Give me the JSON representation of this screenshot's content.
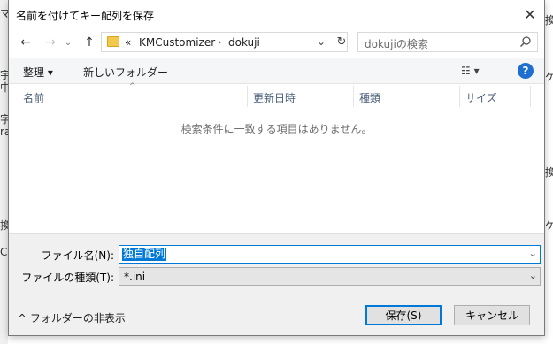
{
  "dialog": {
    "title": "名前を付けてキー配列を保存",
    "close_glyph": "✕"
  },
  "nav": {
    "back_glyph": "←",
    "forward_glyph": "→",
    "recent_glyph": "⌄",
    "up_glyph": "↑"
  },
  "address": {
    "overflow": "«",
    "segments": [
      "KMCustomizer",
      "dokuji"
    ],
    "separator": "›",
    "dropdown_glyph": "⌄",
    "refresh_glyph": "↻"
  },
  "search": {
    "placeholder": "dokujiの検索",
    "icon": "search-icon"
  },
  "commandbar": {
    "organize_label": "整理 ▾",
    "new_folder_label": "新しいフォルダー",
    "view_label": "☷ ▾",
    "help_label": "?"
  },
  "columns": [
    "名前",
    "更新日時",
    "種類",
    "サイズ"
  ],
  "sort_indicator": "^",
  "empty_message": "検索条件に一致する項目はありません。",
  "form": {
    "filename_label": "ファイル名(N):",
    "filename_value": "独自配列",
    "filetype_label": "ファイルの種類(T):",
    "filetype_value": "*.ini",
    "dropdown_glyph": "⌄"
  },
  "footer": {
    "toggle_label": "^ フォルダーの非表示",
    "save_label": "保存(S)",
    "cancel_label": "キャンセル"
  },
  "background_fragments": [
    "マ",
    "宇",
    "中",
    "字",
    "ra",
    "一",
    "換",
    "C",
    "換",
    "ケ",
    "換",
    "ケ"
  ],
  "colors": {
    "accent": "#0078d7",
    "help_blue": "#1f6fd1",
    "header_text": "#4c607a",
    "folder": "#f2c94c"
  }
}
